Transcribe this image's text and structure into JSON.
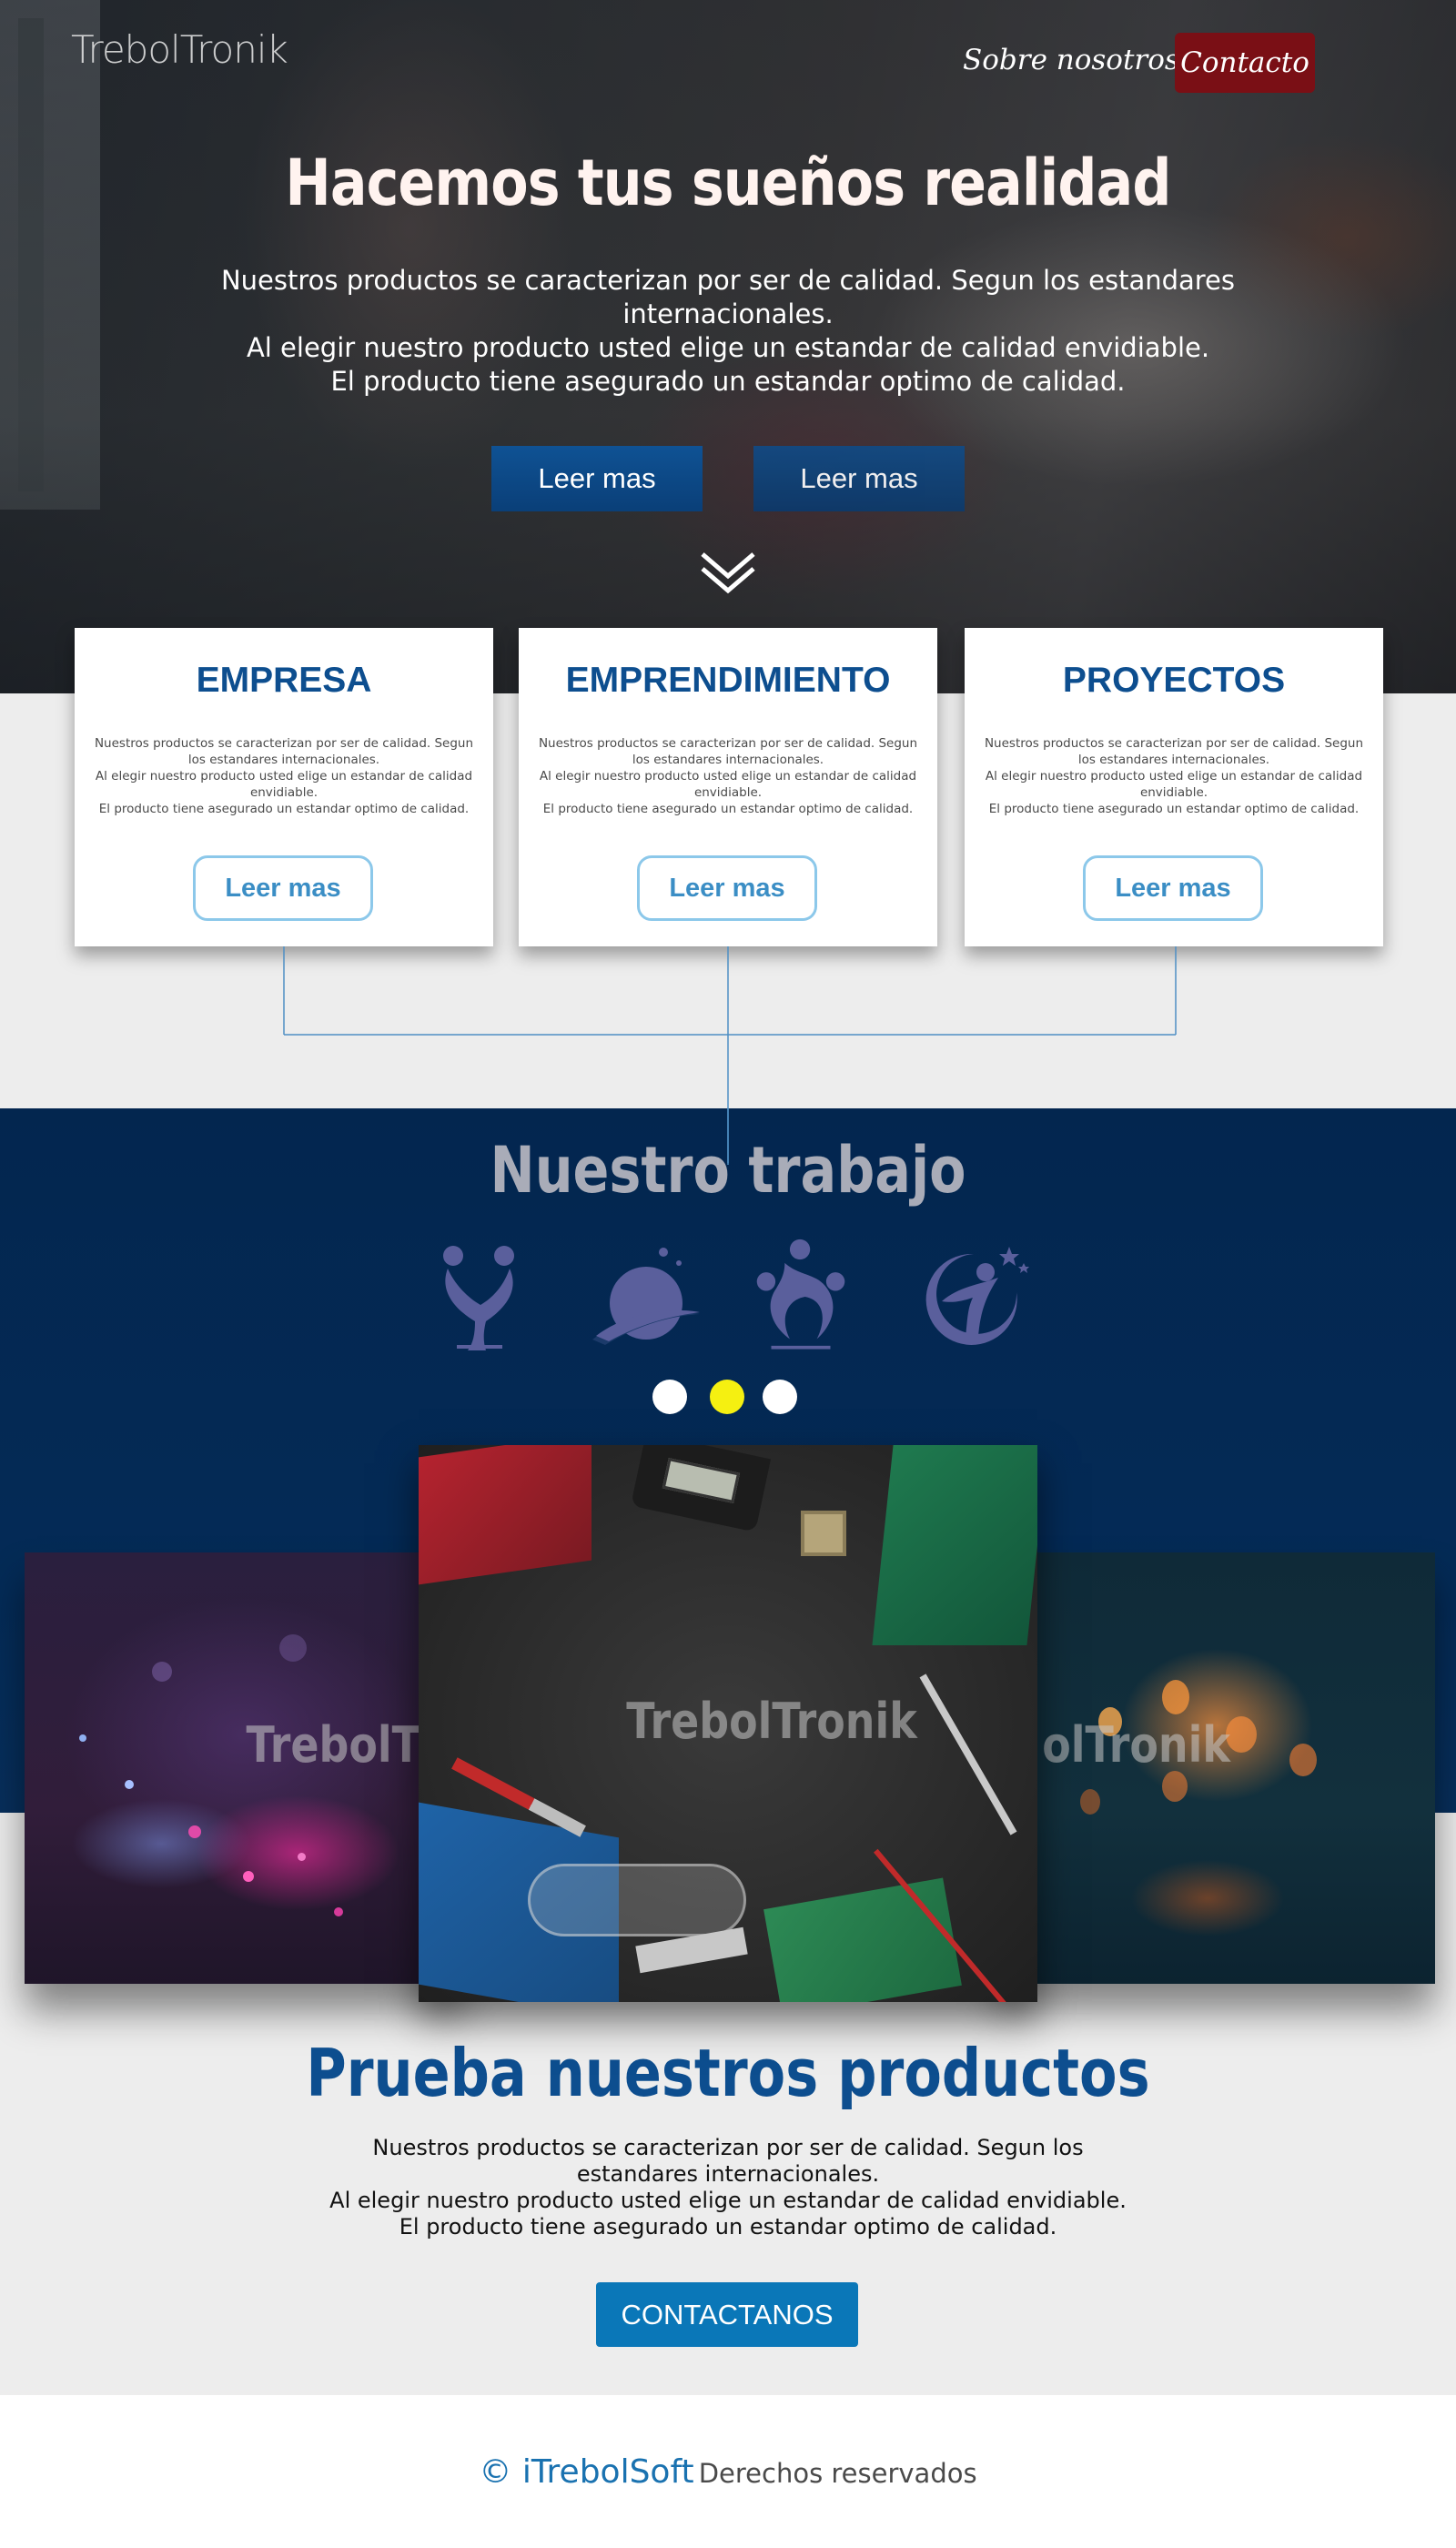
{
  "header": {
    "logo": "TrebolTronik",
    "nav": {
      "about": "Sobre nosotros",
      "contact": "Contacto"
    }
  },
  "hero": {
    "title": "Hacemos tus sueños realidad",
    "lines": [
      "Nuestros productos se caracterizan por ser de calidad. Segun los estandares internacionales.",
      "Al elegir nuestro producto usted elige un estandar de calidad envidiable.",
      "El producto tiene asegurado un estandar optimo de calidad."
    ],
    "buttons": [
      "Leer mas",
      "Leer mas"
    ],
    "scroll_icon": "double-chevron-down-icon"
  },
  "cards": [
    {
      "title": "EMPRESA",
      "lines": [
        "Nuestros productos se caracterizan por ser de calidad. Segun los estandares internacionales.",
        "Al elegir nuestro producto usted elige un estandar de calidad envidiable.",
        "El producto tiene asegurado un estandar optimo de calidad."
      ],
      "button": "Leer mas"
    },
    {
      "title": "EMPRENDIMIENTO",
      "lines": [
        "Nuestros productos se caracterizan por ser de calidad. Segun los estandares internacionales.",
        "Al elegir nuestro producto usted elige un estandar de calidad envidiable.",
        "El producto tiene asegurado un estandar optimo de calidad."
      ],
      "button": "Leer mas"
    },
    {
      "title": "PROYECTOS",
      "lines": [
        "Nuestros productos se caracterizan por ser de calidad. Segun los estandares internacionales.",
        "Al elegir nuestro producto usted elige un estandar de calidad envidiable.",
        "El producto tiene asegurado un estandar optimo de calidad."
      ],
      "button": "Leer mas"
    }
  ],
  "work": {
    "title": "Nuestro trabajo",
    "icons": [
      "people-embrace-icon",
      "globe-swoosh-icon",
      "team-circle-icon",
      "star-person-icon"
    ],
    "carousel": {
      "dots": 3,
      "active_dot": 2
    },
    "slides": {
      "watermark": "TrebolTronik",
      "left_watermark": "TrebolTr",
      "right_watermark": "olTronik"
    }
  },
  "products": {
    "title": "Prueba nuestros productos",
    "lines": [
      "Nuestros productos se caracterizan por ser de calidad. Segun los estandares internacionales.",
      "Al elegir nuestro producto usted elige un estandar de calidad envidiable.",
      "El producto tiene asegurado un estandar optimo de calidad."
    ],
    "button": "CONTACTANOS"
  },
  "footer": {
    "brand": "© iTrebolSoft",
    "rest": "Derechos reservados"
  },
  "colors": {
    "brand_blue": "#0d4e8f",
    "contact_red": "#7a0f15",
    "work_bg": "#03264f",
    "dot_active": "#f5f011",
    "dot_inactive": "#ffffff",
    "card_button_border": "#8cc8ea",
    "cta_blue": "#0a77b8"
  }
}
